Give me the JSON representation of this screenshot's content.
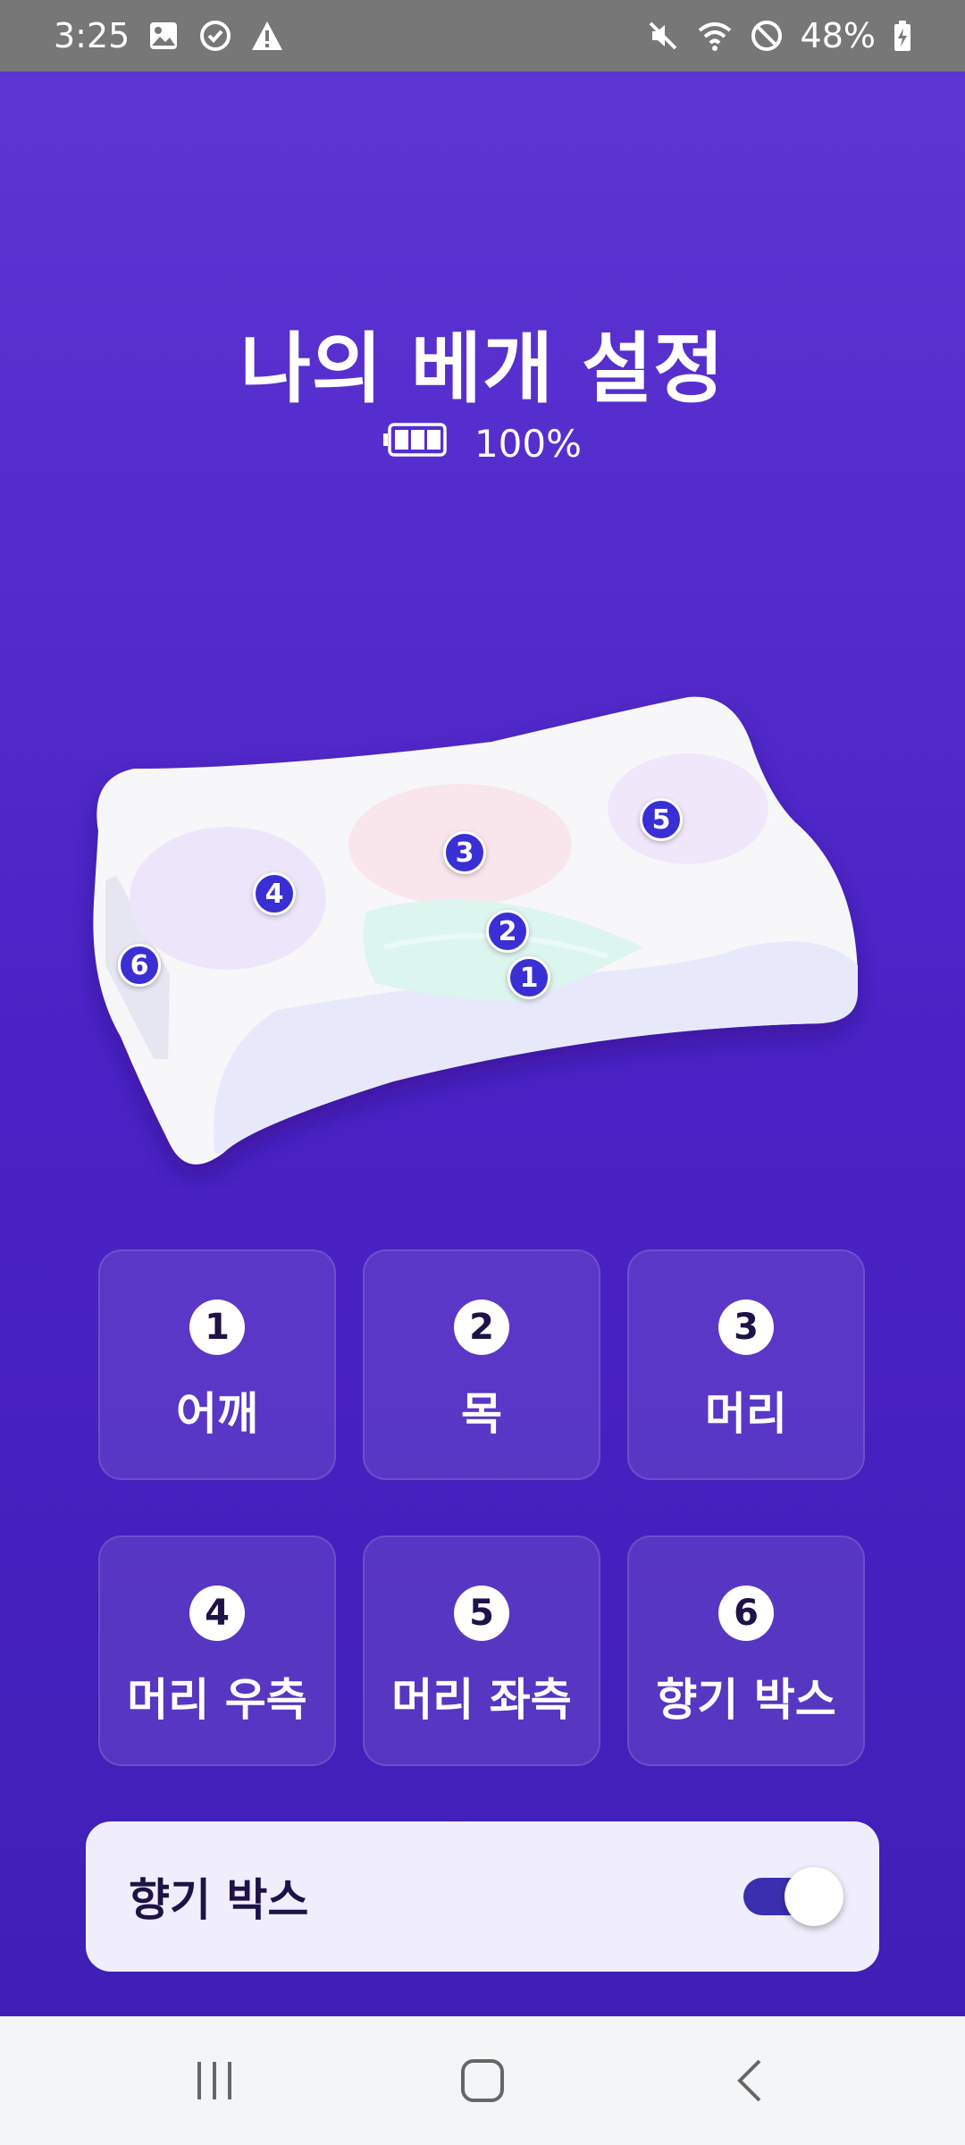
{
  "status_bar": {
    "time": "3:25",
    "battery": "48%",
    "left_icons": [
      "gallery-icon",
      "sync-icon",
      "warning-icon"
    ],
    "right_icons": [
      "mute-icon",
      "wifi-icon",
      "do-not-disturb-icon",
      "battery-charging-icon"
    ]
  },
  "page": {
    "title": "나의 베개 설정",
    "battery_percent": "100%",
    "battery_level": 1.0
  },
  "pillow_markers": [
    "1",
    "2",
    "3",
    "4",
    "5",
    "6"
  ],
  "zones": [
    {
      "number": "1",
      "label": "어깨"
    },
    {
      "number": "2",
      "label": "목"
    },
    {
      "number": "3",
      "label": "머리"
    },
    {
      "number": "4",
      "label": "머리 우측"
    },
    {
      "number": "5",
      "label": "머리 좌측"
    },
    {
      "number": "6",
      "label": "향기 박스"
    }
  ],
  "scent_box": {
    "label": "향기 박스",
    "enabled": true
  },
  "colors": {
    "background_top": "#5c35d2",
    "background_bottom": "#401fb6",
    "marker": "#3a2fd4",
    "toggle_on": "#3a2faf"
  }
}
